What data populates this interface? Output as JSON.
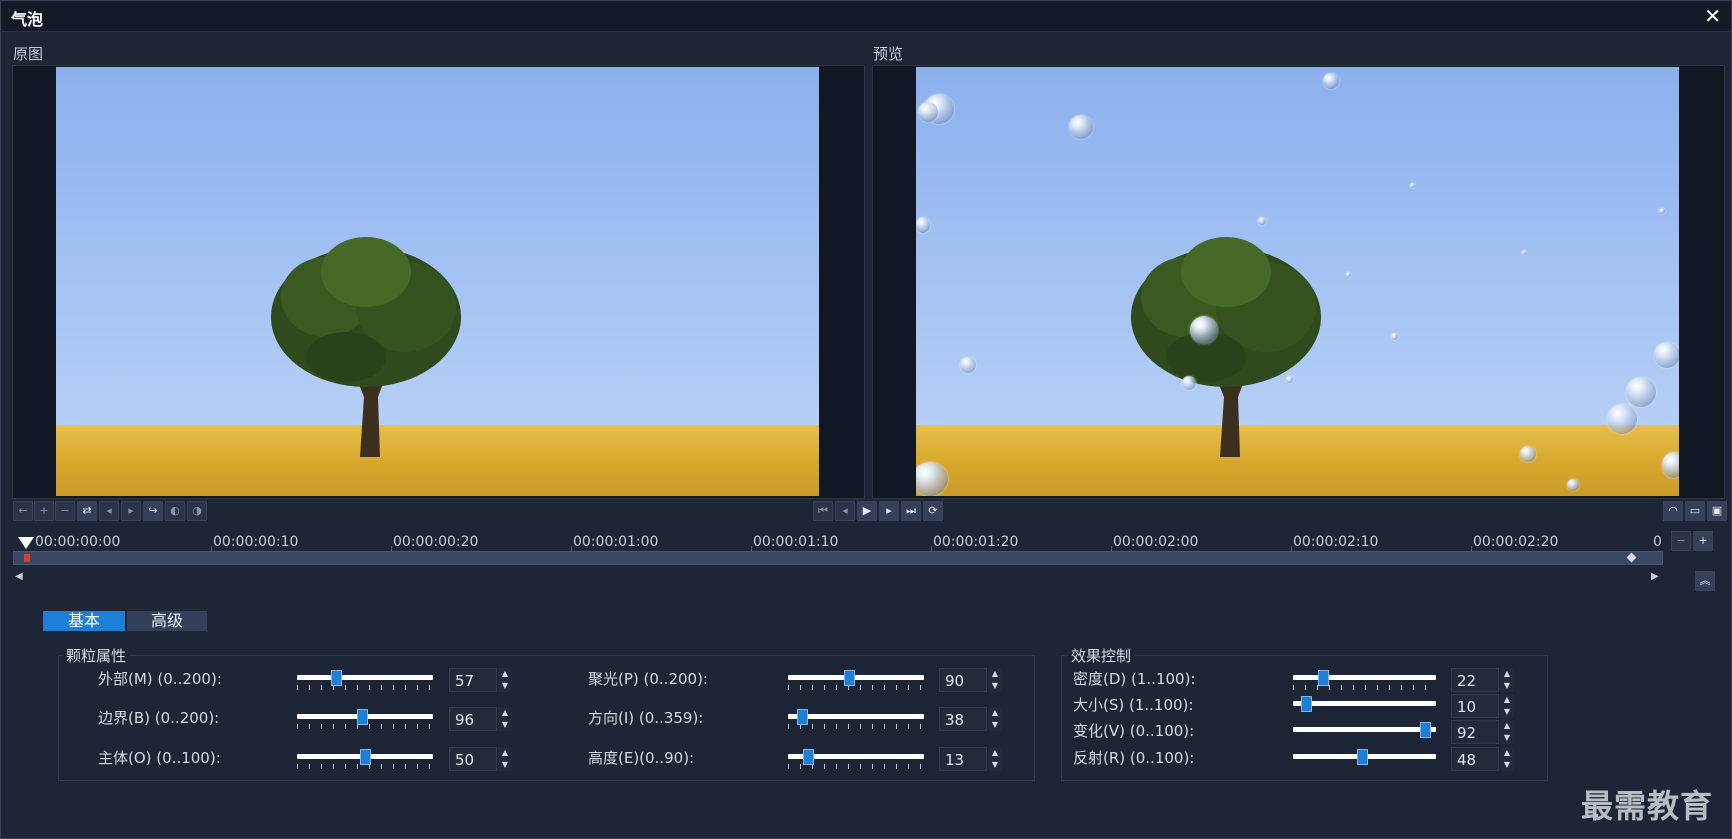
{
  "window": {
    "title": "气泡",
    "close_glyph": "✕"
  },
  "original_label": "原图",
  "preview_label": "预览",
  "playback": {
    "icons": [
      "go-start-icon",
      "prev-frame-icon",
      "play-icon",
      "next-frame-icon",
      "go-end-icon",
      "repeat-icon"
    ]
  },
  "timeline": {
    "timecodes": [
      "00:00:00:00",
      "00:00:00:10",
      "00:00:00:20",
      "00:00:01:00",
      "00:00:01:10",
      "00:00:01:20",
      "00:00:02:00",
      "00:00:02:10",
      "00:00:02:20",
      "0"
    ]
  },
  "tabs": {
    "basic": "基本",
    "advanced": "高级",
    "active": "basic"
  },
  "particle_group": {
    "title": "颗粒属性",
    "params": [
      {
        "label": "外部(M) (0..200):",
        "value": "57",
        "fraction": 0.285
      },
      {
        "label": "边界(B) (0..200):",
        "value": "96",
        "fraction": 0.48
      },
      {
        "label": "主体(O) (0..100):",
        "value": "50",
        "fraction": 0.5
      },
      {
        "label": "聚光(P) (0..200):",
        "value": "90",
        "fraction": 0.45
      },
      {
        "label": "方向(I) (0..359):",
        "value": "38",
        "fraction": 0.106
      },
      {
        "label": "高度(E)(0..90):",
        "value": "13",
        "fraction": 0.144
      }
    ]
  },
  "effect_group": {
    "title": "效果控制",
    "params": [
      {
        "label": "密度(D) (1..100):",
        "value": "22",
        "fraction": 0.21
      },
      {
        "label": "大小(S) (1..100):",
        "value": "10",
        "fraction": 0.09
      },
      {
        "label": "变化(V) (0..100):",
        "value": "92",
        "fraction": 0.92
      },
      {
        "label": "反射(R) (0..100):",
        "value": "48",
        "fraction": 0.48
      }
    ]
  },
  "watermark": "最需教育"
}
